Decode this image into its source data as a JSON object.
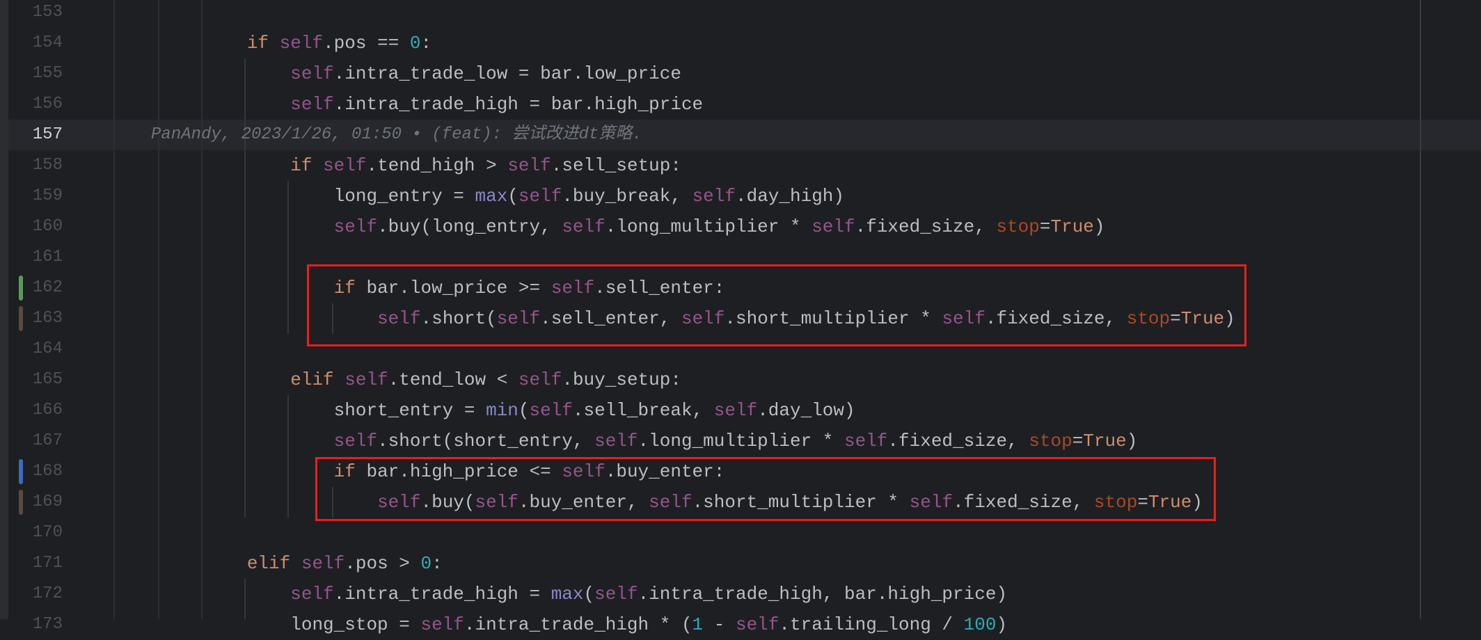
{
  "colors": {
    "keyword": "#cf8e6d",
    "self": "#94558d",
    "builtin": "#8888c6",
    "number": "#2aacb8",
    "param": "#aa4926",
    "text": "#bcbec4",
    "highlight_box": "#e8201c",
    "added": "#5a9a5c",
    "modified": "#3b6bbf",
    "changed": "#5a4a43"
  },
  "editor": {
    "current_line": 157,
    "blame": {
      "author": "PanAndy",
      "date": "2023/1/26, 01:50",
      "sep": " • ",
      "message": "(feat): 尝试改进dt策略."
    },
    "lines": [
      {
        "n": 153,
        "indent": 0,
        "tokens": []
      },
      {
        "n": 154,
        "indent": 8,
        "tokens": [
          [
            "kw",
            "if"
          ],
          [
            "plain",
            " "
          ],
          [
            "self",
            "self"
          ],
          [
            "plain",
            ".pos == "
          ],
          [
            "num",
            "0"
          ],
          [
            "plain",
            ":"
          ]
        ]
      },
      {
        "n": 155,
        "indent": 12,
        "tokens": [
          [
            "self",
            "self"
          ],
          [
            "plain",
            ".intra_trade_low = bar.low_price"
          ]
        ]
      },
      {
        "n": 156,
        "indent": 12,
        "tokens": [
          [
            "self",
            "self"
          ],
          [
            "plain",
            ".intra_trade_high = bar.high_price"
          ]
        ]
      },
      {
        "n": 157,
        "indent": 0,
        "tokens": [],
        "blame": true
      },
      {
        "n": 158,
        "indent": 12,
        "tokens": [
          [
            "kw",
            "if"
          ],
          [
            "plain",
            " "
          ],
          [
            "self",
            "self"
          ],
          [
            "plain",
            ".tend_high > "
          ],
          [
            "self",
            "self"
          ],
          [
            "plain",
            ".sell_setup:"
          ]
        ]
      },
      {
        "n": 159,
        "indent": 16,
        "tokens": [
          [
            "plain",
            "long_entry = "
          ],
          [
            "builtin",
            "max"
          ],
          [
            "plain",
            "("
          ],
          [
            "self",
            "self"
          ],
          [
            "plain",
            ".buy_break, "
          ],
          [
            "self",
            "self"
          ],
          [
            "plain",
            ".day_high)"
          ]
        ]
      },
      {
        "n": 160,
        "indent": 16,
        "tokens": [
          [
            "self",
            "self"
          ],
          [
            "plain",
            ".buy(long_entry, "
          ],
          [
            "self",
            "self"
          ],
          [
            "plain",
            ".long_multiplier * "
          ],
          [
            "self",
            "self"
          ],
          [
            "plain",
            ".fixed_size, "
          ],
          [
            "param",
            "stop"
          ],
          [
            "plain",
            "="
          ],
          [
            "kw",
            "True"
          ],
          [
            "plain",
            ")"
          ]
        ]
      },
      {
        "n": 161,
        "indent": 0,
        "tokens": []
      },
      {
        "n": 162,
        "indent": 16,
        "marker": "added",
        "tokens": [
          [
            "kw",
            "if"
          ],
          [
            "plain",
            " bar.low_price >= "
          ],
          [
            "self",
            "self"
          ],
          [
            "plain",
            ".sell_enter:"
          ]
        ]
      },
      {
        "n": 163,
        "indent": 20,
        "marker": "changed",
        "tokens": [
          [
            "self",
            "self"
          ],
          [
            "plain",
            ".short("
          ],
          [
            "self",
            "self"
          ],
          [
            "plain",
            ".sell_enter, "
          ],
          [
            "self",
            "self"
          ],
          [
            "plain",
            ".short_multiplier * "
          ],
          [
            "self",
            "self"
          ],
          [
            "plain",
            ".fixed_size, "
          ],
          [
            "param",
            "stop"
          ],
          [
            "plain",
            "="
          ],
          [
            "kw",
            "True"
          ],
          [
            "plain",
            ")"
          ]
        ]
      },
      {
        "n": 164,
        "indent": 0,
        "tokens": []
      },
      {
        "n": 165,
        "indent": 12,
        "tokens": [
          [
            "kw",
            "elif"
          ],
          [
            "plain",
            " "
          ],
          [
            "self",
            "self"
          ],
          [
            "plain",
            ".tend_low < "
          ],
          [
            "self",
            "self"
          ],
          [
            "plain",
            ".buy_setup:"
          ]
        ]
      },
      {
        "n": 166,
        "indent": 16,
        "tokens": [
          [
            "plain",
            "short_entry = "
          ],
          [
            "builtin",
            "min"
          ],
          [
            "plain",
            "("
          ],
          [
            "self",
            "self"
          ],
          [
            "plain",
            ".sell_break, "
          ],
          [
            "self",
            "self"
          ],
          [
            "plain",
            ".day_low)"
          ]
        ]
      },
      {
        "n": 167,
        "indent": 16,
        "tokens": [
          [
            "self",
            "self"
          ],
          [
            "plain",
            ".short(short_entry, "
          ],
          [
            "self",
            "self"
          ],
          [
            "plain",
            ".long_multiplier * "
          ],
          [
            "self",
            "self"
          ],
          [
            "plain",
            ".fixed_size, "
          ],
          [
            "param",
            "stop"
          ],
          [
            "plain",
            "="
          ],
          [
            "kw",
            "True"
          ],
          [
            "plain",
            ")"
          ]
        ]
      },
      {
        "n": 168,
        "indent": 16,
        "marker": "modified",
        "tokens": [
          [
            "kw",
            "if"
          ],
          [
            "plain",
            " bar.high_price <= "
          ],
          [
            "self",
            "self"
          ],
          [
            "plain",
            ".buy_enter:"
          ]
        ]
      },
      {
        "n": 169,
        "indent": 20,
        "marker": "changed",
        "tokens": [
          [
            "self",
            "self"
          ],
          [
            "plain",
            ".buy("
          ],
          [
            "self",
            "self"
          ],
          [
            "plain",
            ".buy_enter, "
          ],
          [
            "self",
            "self"
          ],
          [
            "plain",
            ".short_multiplier * "
          ],
          [
            "self",
            "self"
          ],
          [
            "plain",
            ".fixed_size, "
          ],
          [
            "param",
            "stop"
          ],
          [
            "plain",
            "="
          ],
          [
            "kw",
            "True"
          ],
          [
            "plain",
            ")"
          ]
        ]
      },
      {
        "n": 170,
        "indent": 0,
        "tokens": []
      },
      {
        "n": 171,
        "indent": 8,
        "tokens": [
          [
            "kw",
            "elif"
          ],
          [
            "plain",
            " "
          ],
          [
            "self",
            "self"
          ],
          [
            "plain",
            ".pos > "
          ],
          [
            "num",
            "0"
          ],
          [
            "plain",
            ":"
          ]
        ]
      },
      {
        "n": 172,
        "indent": 12,
        "tokens": [
          [
            "self",
            "self"
          ],
          [
            "plain",
            ".intra_trade_high = "
          ],
          [
            "builtin",
            "max"
          ],
          [
            "plain",
            "("
          ],
          [
            "self",
            "self"
          ],
          [
            "plain",
            ".intra_trade_high, bar.high_price)"
          ]
        ]
      },
      {
        "n": 173,
        "indent": 12,
        "tokens": [
          [
            "plain",
            "long_stop = "
          ],
          [
            "self",
            "self"
          ],
          [
            "plain",
            ".intra_trade_high * ("
          ],
          [
            "num",
            "1"
          ],
          [
            "plain",
            " - "
          ],
          [
            "self",
            "self"
          ],
          [
            "plain",
            ".trailing_long / "
          ],
          [
            "num",
            "100"
          ],
          [
            "plain",
            ")"
          ]
        ]
      }
    ]
  }
}
